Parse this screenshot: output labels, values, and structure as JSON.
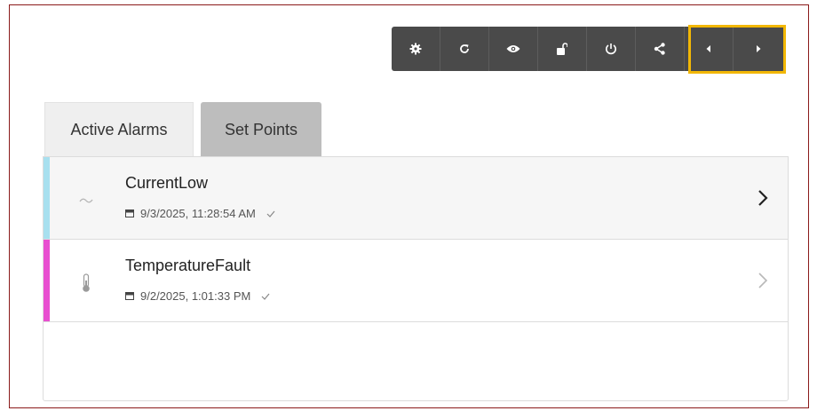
{
  "toolbar": {
    "buttons": [
      {
        "name": "settings",
        "icon": "gear-icon"
      },
      {
        "name": "refresh",
        "icon": "refresh-icon"
      },
      {
        "name": "view",
        "icon": "eye-icon"
      },
      {
        "name": "unlock",
        "icon": "unlock-icon"
      },
      {
        "name": "power",
        "icon": "power-icon"
      },
      {
        "name": "share",
        "icon": "share-icon"
      },
      {
        "name": "previous",
        "icon": "caret-left-icon"
      },
      {
        "name": "next",
        "icon": "caret-right-icon"
      }
    ],
    "background": "#4a4a4a",
    "highlight_color": "#f2b705"
  },
  "tabs": [
    {
      "label": "Active Alarms",
      "active": true
    },
    {
      "label": "Set Points",
      "active": false
    }
  ],
  "alarms": [
    {
      "title": "CurrentLow",
      "timestamp": "9/3/2025, 11:28:54 AM",
      "icon": "wave-icon",
      "stripe_color": "#a8e0ef"
    },
    {
      "title": "TemperatureFault",
      "timestamp": "9/2/2025, 1:01:33 PM",
      "icon": "thermometer-icon",
      "stripe_color": "#e84fd0"
    }
  ]
}
